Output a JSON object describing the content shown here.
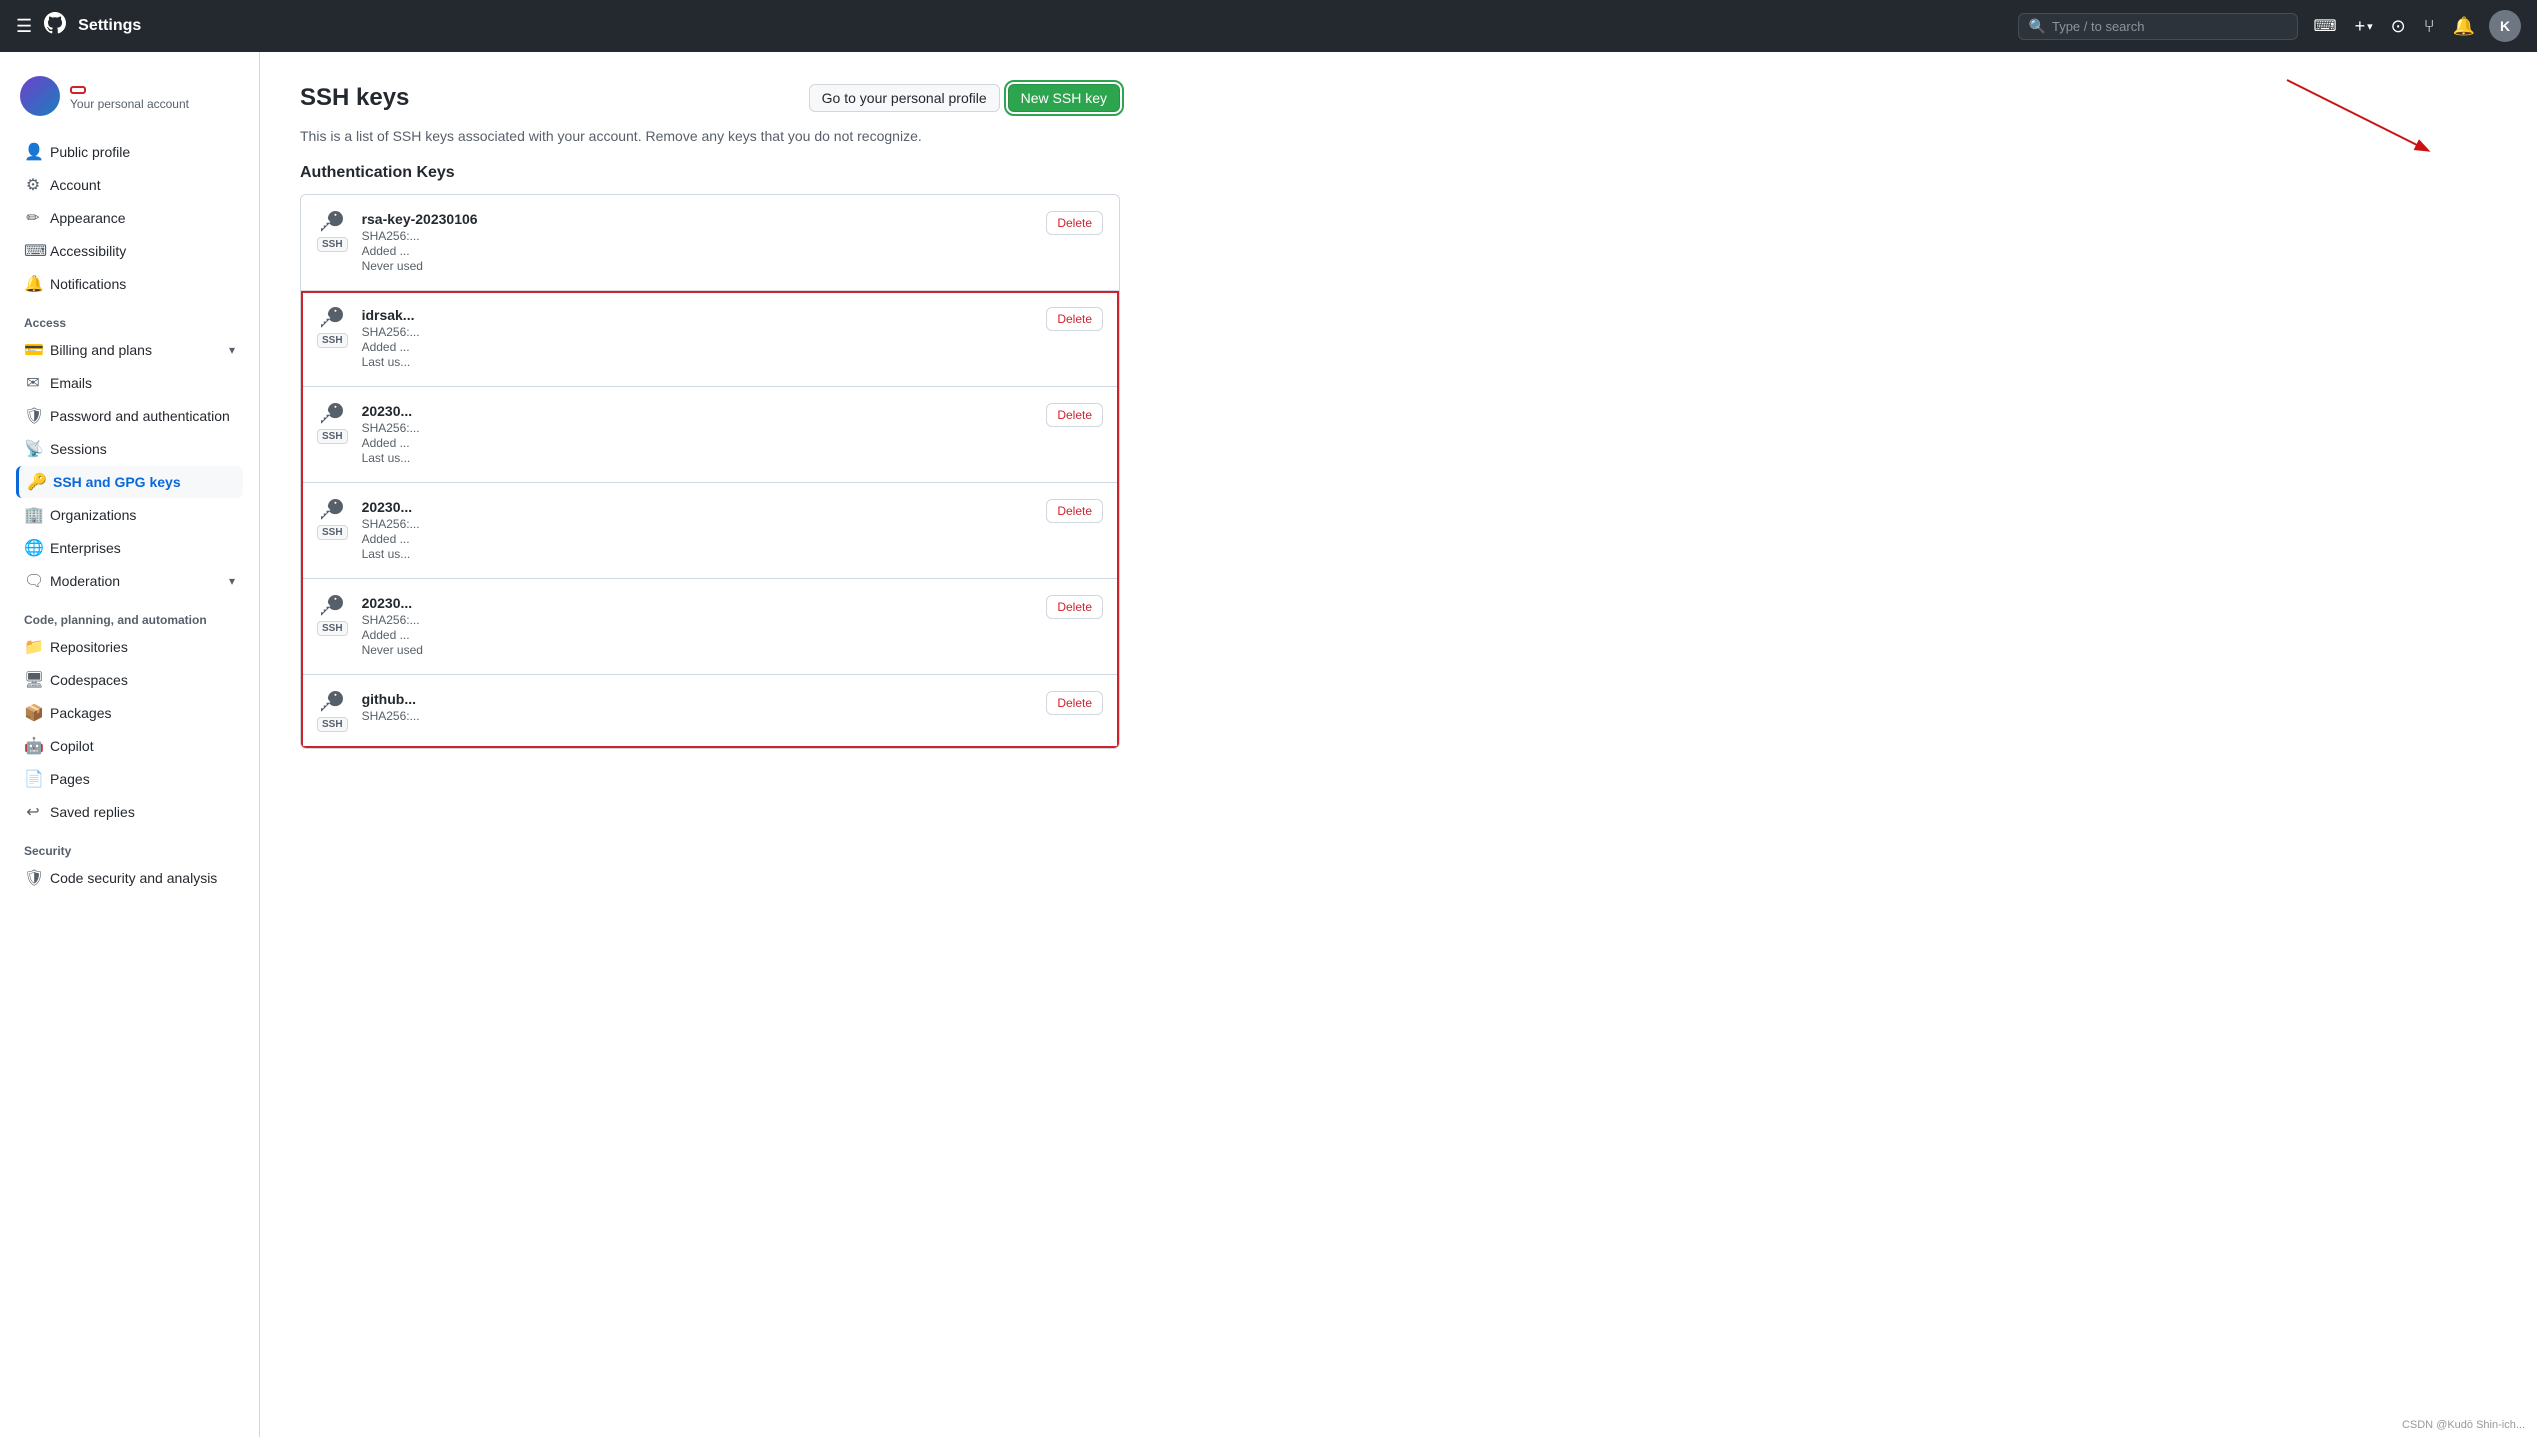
{
  "topnav": {
    "title": "Settings",
    "search_placeholder": "Type / to search",
    "plus_label": "+",
    "logo": "⬤"
  },
  "sidebar": {
    "username": "",
    "personal_account_label": "Your personal account",
    "items": [
      {
        "id": "public-profile",
        "label": "Public profile",
        "icon": "👤"
      },
      {
        "id": "account",
        "label": "Account",
        "icon": "⚙"
      },
      {
        "id": "appearance",
        "label": "Appearance",
        "icon": "✏"
      },
      {
        "id": "accessibility",
        "label": "Accessibility",
        "icon": "⌨"
      },
      {
        "id": "notifications",
        "label": "Notifications",
        "icon": "🔔"
      }
    ],
    "access_label": "Access",
    "access_items": [
      {
        "id": "billing",
        "label": "Billing and plans",
        "icon": "💳",
        "expandable": true
      },
      {
        "id": "emails",
        "label": "Emails",
        "icon": "✉"
      },
      {
        "id": "password",
        "label": "Password and authentication",
        "icon": "🛡"
      },
      {
        "id": "sessions",
        "label": "Sessions",
        "icon": "📡"
      },
      {
        "id": "ssh-gpg",
        "label": "SSH and GPG keys",
        "icon": "🔑",
        "active": true
      },
      {
        "id": "organizations",
        "label": "Organizations",
        "icon": "🏢"
      },
      {
        "id": "enterprises",
        "label": "Enterprises",
        "icon": "🌐"
      },
      {
        "id": "moderation",
        "label": "Moderation",
        "icon": "🗨",
        "expandable": true
      }
    ],
    "code_label": "Code, planning, and automation",
    "code_items": [
      {
        "id": "repositories",
        "label": "Repositories",
        "icon": "📁"
      },
      {
        "id": "codespaces",
        "label": "Codespaces",
        "icon": "🖥"
      },
      {
        "id": "packages",
        "label": "Packages",
        "icon": "📦"
      },
      {
        "id": "copilot",
        "label": "Copilot",
        "icon": "🤖"
      },
      {
        "id": "pages",
        "label": "Pages",
        "icon": "📄"
      },
      {
        "id": "saved-replies",
        "label": "Saved replies",
        "icon": "↩"
      }
    ],
    "security_label": "Security",
    "security_items": [
      {
        "id": "code-security",
        "label": "Code security and analysis",
        "icon": "🛡"
      }
    ]
  },
  "main": {
    "page_title": "SSH keys",
    "go_to_profile_label": "Go to your personal profile",
    "new_ssh_key_label": "New SSH key",
    "description": "This is a list of SSH keys associated with your account. Remove any keys that you do not recognize.",
    "auth_keys_heading": "Authentication Keys",
    "keys": [
      {
        "name": "rsa-key-20230106",
        "sha": "SHA256:...",
        "added": "Added ...",
        "last_used": "Never used",
        "type": "SSH"
      },
      {
        "name": "idrsak...",
        "sha": "SHA256:...",
        "added": "Added ...",
        "last_used": "Last us...",
        "type": "SSH"
      },
      {
        "name": "20230...",
        "sha": "SHA256:...",
        "added": "Added ...",
        "last_used": "Last us...",
        "type": "SSH"
      },
      {
        "name": "20230...",
        "sha": "SHA256:...",
        "added": "Added ...",
        "last_used": "Last us...",
        "type": "SSH"
      },
      {
        "name": "20230...",
        "sha": "SHA256:...",
        "added": "Added ...",
        "last_used": "Never used",
        "type": "SSH"
      },
      {
        "name": "github...",
        "sha": "SHA256:...",
        "added": "",
        "last_used": "",
        "type": "SSH"
      }
    ],
    "delete_label": "Delete"
  },
  "watermark": "CSDN @Kudō Shin-ich..."
}
